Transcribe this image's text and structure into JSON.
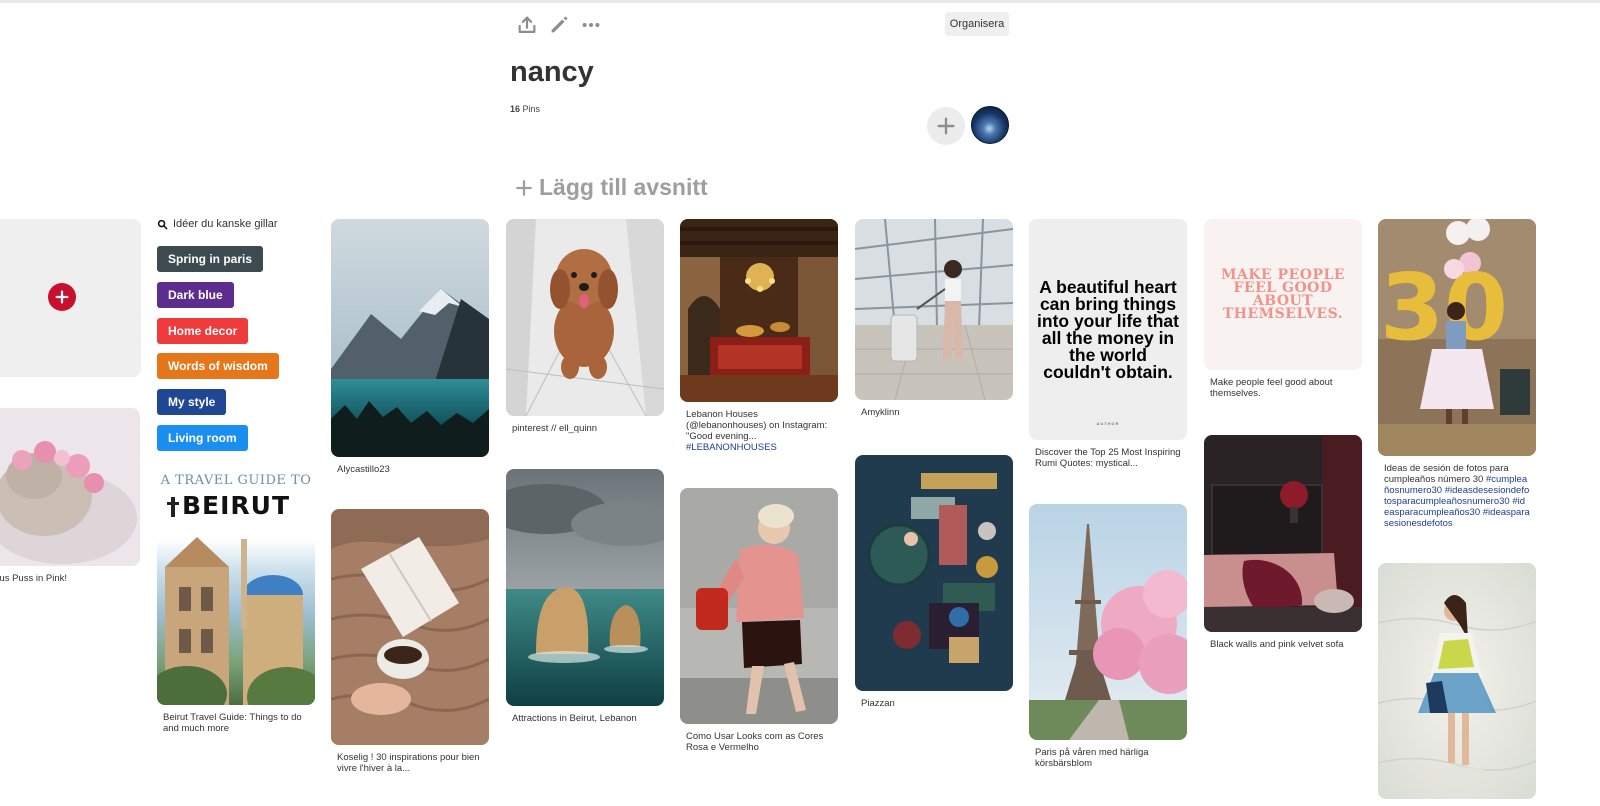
{
  "toolbar": {
    "organise_label": "Organisera"
  },
  "board": {
    "title": "nancy",
    "pin_count": "16",
    "pins_word": "Pins"
  },
  "add_section_label": "Lägg till avsnitt",
  "ideas": {
    "header": "Idéer du kanske gillar",
    "buttons": [
      {
        "label": "Spring in paris",
        "color": "#3d4a4f"
      },
      {
        "label": "Dark blue",
        "color": "#5c2d8f"
      },
      {
        "label": "Home decor",
        "color": "#ef3b3b"
      },
      {
        "label": "Words of wisdom",
        "color": "#e6761a"
      },
      {
        "label": "My style",
        "color": "#1f4794"
      },
      {
        "label": "Living room",
        "color": "#1b8ff0"
      }
    ]
  },
  "pins": {
    "puss": {
      "caption": "ecious Puss in Pink!"
    },
    "beirut_guide": {
      "caption": "Beirut Travel Guide: Things to do and much more",
      "overlay_top": "A TRAVEL GUIDE TO",
      "overlay_big": "BEIRUT"
    },
    "alycastillo": {
      "caption": "Alycastillo23"
    },
    "koselig": {
      "caption": "Koselig ! 30 inspirations pour bien vivre l'hiver à la..."
    },
    "pinterest_ell": {
      "caption": "pinterest // ell_quinn"
    },
    "attractions": {
      "caption": "Attractions in Beirut, Lebanon"
    },
    "lebanon_houses": {
      "caption": "Lebanon Houses (@lebanonhouses) on Instagram: \"Good evening...",
      "hashtag": "#LEBANONHOUSES"
    },
    "como_usar": {
      "caption": "Como Usar Looks com as Cores Rosa e Vermelho"
    },
    "amyklinn": {
      "caption": "Amyklinn"
    },
    "piazzan": {
      "caption": "Piazzan"
    },
    "rumi": {
      "caption": "Discover the Top 25 Most Inspiring Rumi Quotes: mystical...",
      "quote": "A beautiful heart can bring things into your life that all the money in the world couldn't obtain.",
      "quote_footer": "AUTHOR"
    },
    "paris": {
      "caption": "Paris på våren med härliga körsbärsblom"
    },
    "make_people": {
      "caption": "Make people feel good about themselves.",
      "image_text": "MAKE PEOPLE FEEL GOOD ABOUT THEMSELVES."
    },
    "black_walls": {
      "caption": "Black walls and pink velvet sofa"
    },
    "ideas_sesion": {
      "caption": "Ideas de sesión de fotos para cumpleaños número 30",
      "hashtags": "#cumpleañosnumero30 #ideasdesesiondefotosparacumpleañosnumero30 #ideasparacumpleaños30 #ideasparasesionesdefotos",
      "balloon_number": "30"
    }
  }
}
